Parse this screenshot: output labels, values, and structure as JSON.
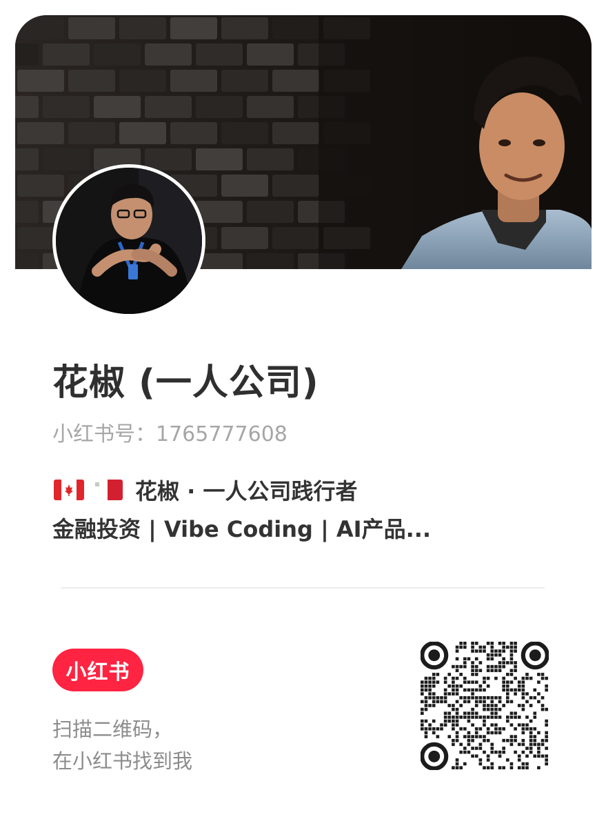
{
  "profile": {
    "name": "花椒 (一人公司)",
    "account_id": "小红书号：1765777608",
    "bio_line1": "花椒 · 一人公司践行者",
    "bio_line2": "金融投资 | Vibe Coding | AI产品...",
    "flags": [
      "canada-flag-icon",
      "malta-flag-icon"
    ]
  },
  "footer": {
    "brand_label": "小红书",
    "scan_line1": "扫描二维码，",
    "scan_line2": "在小红书找到我"
  },
  "icons": {
    "qr": "qr-code-icon"
  },
  "colors": {
    "brand": "#ff2442",
    "text_primary": "#333333",
    "text_secondary": "#a6a6a6"
  }
}
